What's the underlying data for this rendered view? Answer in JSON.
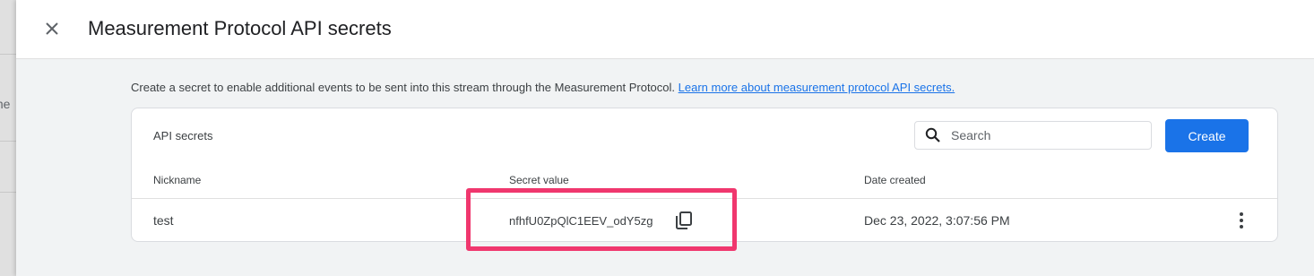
{
  "background": {
    "partial_text": "the"
  },
  "header": {
    "title": "Measurement Protocol API secrets",
    "close_icon": "close-icon"
  },
  "intro": {
    "text": "Create a secret to enable additional events to be sent into this stream through the Measurement Protocol. ",
    "link_label": "Learn more about measurement protocol API secrets."
  },
  "card": {
    "title": "API secrets",
    "search": {
      "placeholder": "Search",
      "value": "",
      "icon": "search-icon"
    },
    "create_label": "Create",
    "columns": [
      "Nickname",
      "Secret value",
      "Date created"
    ],
    "rows": [
      {
        "nickname": "test",
        "secret_value": "nfhfU0ZpQlC1EEV_odY5zg",
        "date_created": "Dec 23, 2022, 3:07:56 PM"
      }
    ]
  },
  "colors": {
    "accent": "#1a73e8",
    "highlight": "#f0376e",
    "background": "#f1f3f4"
  }
}
